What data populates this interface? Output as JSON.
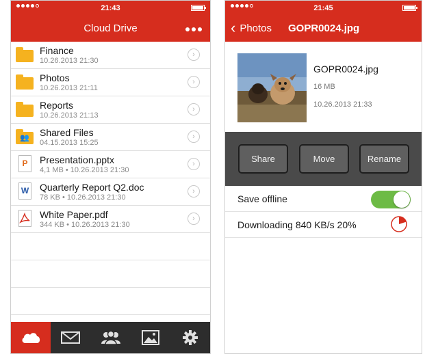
{
  "colors": {
    "brand_red": "#d62d1e",
    "folder": "#f5b21f",
    "toggle_on": "#6dbb45",
    "action_bg": "#4a4a4a"
  },
  "left_screen": {
    "status": {
      "time": "21:43"
    },
    "title": "Cloud Drive",
    "files": [
      {
        "name": "Finance",
        "meta": "10.26.2013 21:30",
        "icon": "folder-icon"
      },
      {
        "name": "Photos",
        "meta": "10.26.2013 21:11",
        "icon": "folder-icon"
      },
      {
        "name": "Reports",
        "meta": "10.26.2013 21:13",
        "icon": "folder-icon"
      },
      {
        "name": "Shared Files",
        "meta": "04.15.2013 15:25",
        "icon": "shared-folder-icon"
      },
      {
        "name": "Presentation.pptx",
        "meta": "4,1 MB • 10.26.2013 21:30",
        "icon": "powerpoint-file-icon"
      },
      {
        "name": "Quarterly Report Q2.doc",
        "meta": "78 KB • 10.26.2013 21:30",
        "icon": "word-file-icon"
      },
      {
        "name": "White Paper.pdf",
        "meta": "344 KB • 10.26.2013 21:30",
        "icon": "pdf-file-icon"
      }
    ],
    "tabs": [
      "cloud-icon",
      "mail-icon",
      "contacts-icon",
      "photos-icon",
      "settings-icon"
    ],
    "active_tab": 0
  },
  "right_screen": {
    "status": {
      "time": "21:45"
    },
    "back_label": "Photos",
    "title": "GOPR0024.jpg",
    "file": {
      "name": "GOPR0024.jpg",
      "size": "16 MB",
      "date": "10.26.2013 21:33"
    },
    "actions": {
      "share": "Share",
      "move": "Move",
      "rename": "Rename"
    },
    "save_offline_label": "Save offline",
    "save_offline_on": true,
    "download_label": "Downloading 840 KB/s 20%",
    "download_progress": 0.2
  }
}
